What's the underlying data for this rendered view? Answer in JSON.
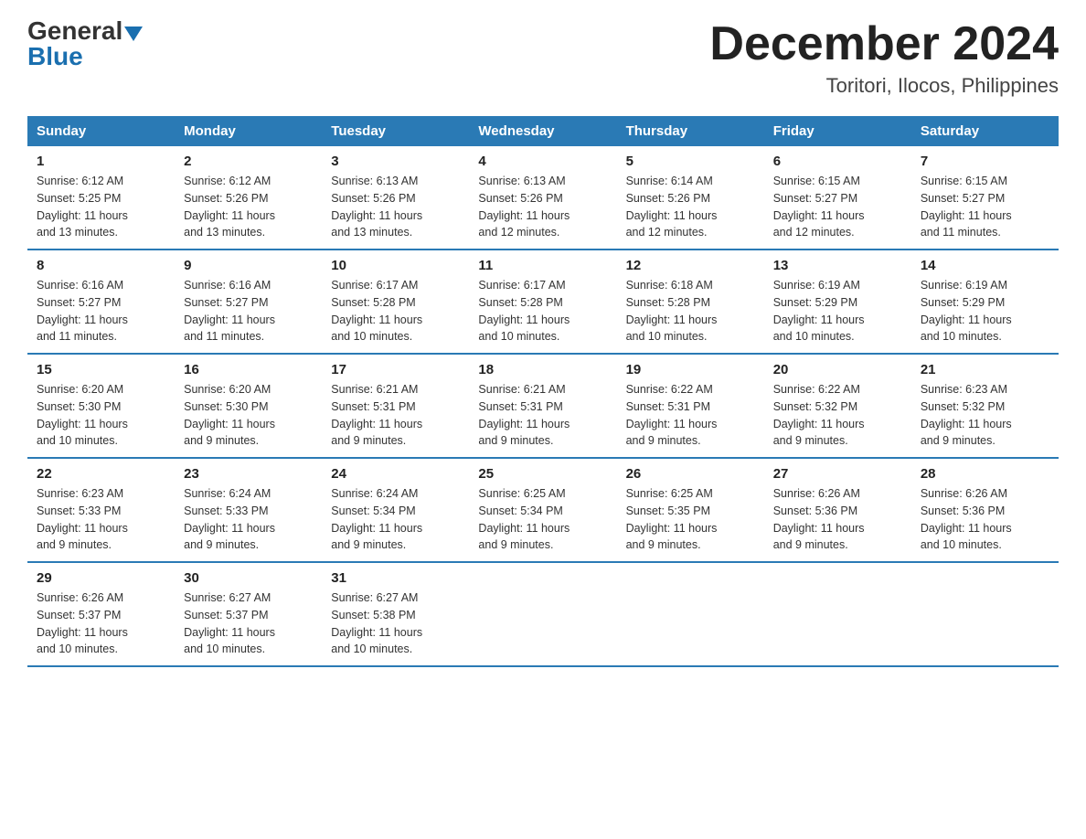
{
  "logo": {
    "general": "General",
    "blue": "Blue"
  },
  "title": {
    "month_year": "December 2024",
    "location": "Toritori, Ilocos, Philippines"
  },
  "headers": [
    "Sunday",
    "Monday",
    "Tuesday",
    "Wednesday",
    "Thursday",
    "Friday",
    "Saturday"
  ],
  "weeks": [
    [
      {
        "day": "1",
        "sunrise": "6:12 AM",
        "sunset": "5:25 PM",
        "daylight": "11 hours and 13 minutes."
      },
      {
        "day": "2",
        "sunrise": "6:12 AM",
        "sunset": "5:26 PM",
        "daylight": "11 hours and 13 minutes."
      },
      {
        "day": "3",
        "sunrise": "6:13 AM",
        "sunset": "5:26 PM",
        "daylight": "11 hours and 13 minutes."
      },
      {
        "day": "4",
        "sunrise": "6:13 AM",
        "sunset": "5:26 PM",
        "daylight": "11 hours and 12 minutes."
      },
      {
        "day": "5",
        "sunrise": "6:14 AM",
        "sunset": "5:26 PM",
        "daylight": "11 hours and 12 minutes."
      },
      {
        "day": "6",
        "sunrise": "6:15 AM",
        "sunset": "5:27 PM",
        "daylight": "11 hours and 12 minutes."
      },
      {
        "day": "7",
        "sunrise": "6:15 AM",
        "sunset": "5:27 PM",
        "daylight": "11 hours and 11 minutes."
      }
    ],
    [
      {
        "day": "8",
        "sunrise": "6:16 AM",
        "sunset": "5:27 PM",
        "daylight": "11 hours and 11 minutes."
      },
      {
        "day": "9",
        "sunrise": "6:16 AM",
        "sunset": "5:27 PM",
        "daylight": "11 hours and 11 minutes."
      },
      {
        "day": "10",
        "sunrise": "6:17 AM",
        "sunset": "5:28 PM",
        "daylight": "11 hours and 10 minutes."
      },
      {
        "day": "11",
        "sunrise": "6:17 AM",
        "sunset": "5:28 PM",
        "daylight": "11 hours and 10 minutes."
      },
      {
        "day": "12",
        "sunrise": "6:18 AM",
        "sunset": "5:28 PM",
        "daylight": "11 hours and 10 minutes."
      },
      {
        "day": "13",
        "sunrise": "6:19 AM",
        "sunset": "5:29 PM",
        "daylight": "11 hours and 10 minutes."
      },
      {
        "day": "14",
        "sunrise": "6:19 AM",
        "sunset": "5:29 PM",
        "daylight": "11 hours and 10 minutes."
      }
    ],
    [
      {
        "day": "15",
        "sunrise": "6:20 AM",
        "sunset": "5:30 PM",
        "daylight": "11 hours and 10 minutes."
      },
      {
        "day": "16",
        "sunrise": "6:20 AM",
        "sunset": "5:30 PM",
        "daylight": "11 hours and 9 minutes."
      },
      {
        "day": "17",
        "sunrise": "6:21 AM",
        "sunset": "5:31 PM",
        "daylight": "11 hours and 9 minutes."
      },
      {
        "day": "18",
        "sunrise": "6:21 AM",
        "sunset": "5:31 PM",
        "daylight": "11 hours and 9 minutes."
      },
      {
        "day": "19",
        "sunrise": "6:22 AM",
        "sunset": "5:31 PM",
        "daylight": "11 hours and 9 minutes."
      },
      {
        "day": "20",
        "sunrise": "6:22 AM",
        "sunset": "5:32 PM",
        "daylight": "11 hours and 9 minutes."
      },
      {
        "day": "21",
        "sunrise": "6:23 AM",
        "sunset": "5:32 PM",
        "daylight": "11 hours and 9 minutes."
      }
    ],
    [
      {
        "day": "22",
        "sunrise": "6:23 AM",
        "sunset": "5:33 PM",
        "daylight": "11 hours and 9 minutes."
      },
      {
        "day": "23",
        "sunrise": "6:24 AM",
        "sunset": "5:33 PM",
        "daylight": "11 hours and 9 minutes."
      },
      {
        "day": "24",
        "sunrise": "6:24 AM",
        "sunset": "5:34 PM",
        "daylight": "11 hours and 9 minutes."
      },
      {
        "day": "25",
        "sunrise": "6:25 AM",
        "sunset": "5:34 PM",
        "daylight": "11 hours and 9 minutes."
      },
      {
        "day": "26",
        "sunrise": "6:25 AM",
        "sunset": "5:35 PM",
        "daylight": "11 hours and 9 minutes."
      },
      {
        "day": "27",
        "sunrise": "6:26 AM",
        "sunset": "5:36 PM",
        "daylight": "11 hours and 9 minutes."
      },
      {
        "day": "28",
        "sunrise": "6:26 AM",
        "sunset": "5:36 PM",
        "daylight": "11 hours and 10 minutes."
      }
    ],
    [
      {
        "day": "29",
        "sunrise": "6:26 AM",
        "sunset": "5:37 PM",
        "daylight": "11 hours and 10 minutes."
      },
      {
        "day": "30",
        "sunrise": "6:27 AM",
        "sunset": "5:37 PM",
        "daylight": "11 hours and 10 minutes."
      },
      {
        "day": "31",
        "sunrise": "6:27 AM",
        "sunset": "5:38 PM",
        "daylight": "11 hours and 10 minutes."
      },
      null,
      null,
      null,
      null
    ]
  ],
  "labels": {
    "sunrise": "Sunrise:",
    "sunset": "Sunset:",
    "daylight": "Daylight:"
  }
}
